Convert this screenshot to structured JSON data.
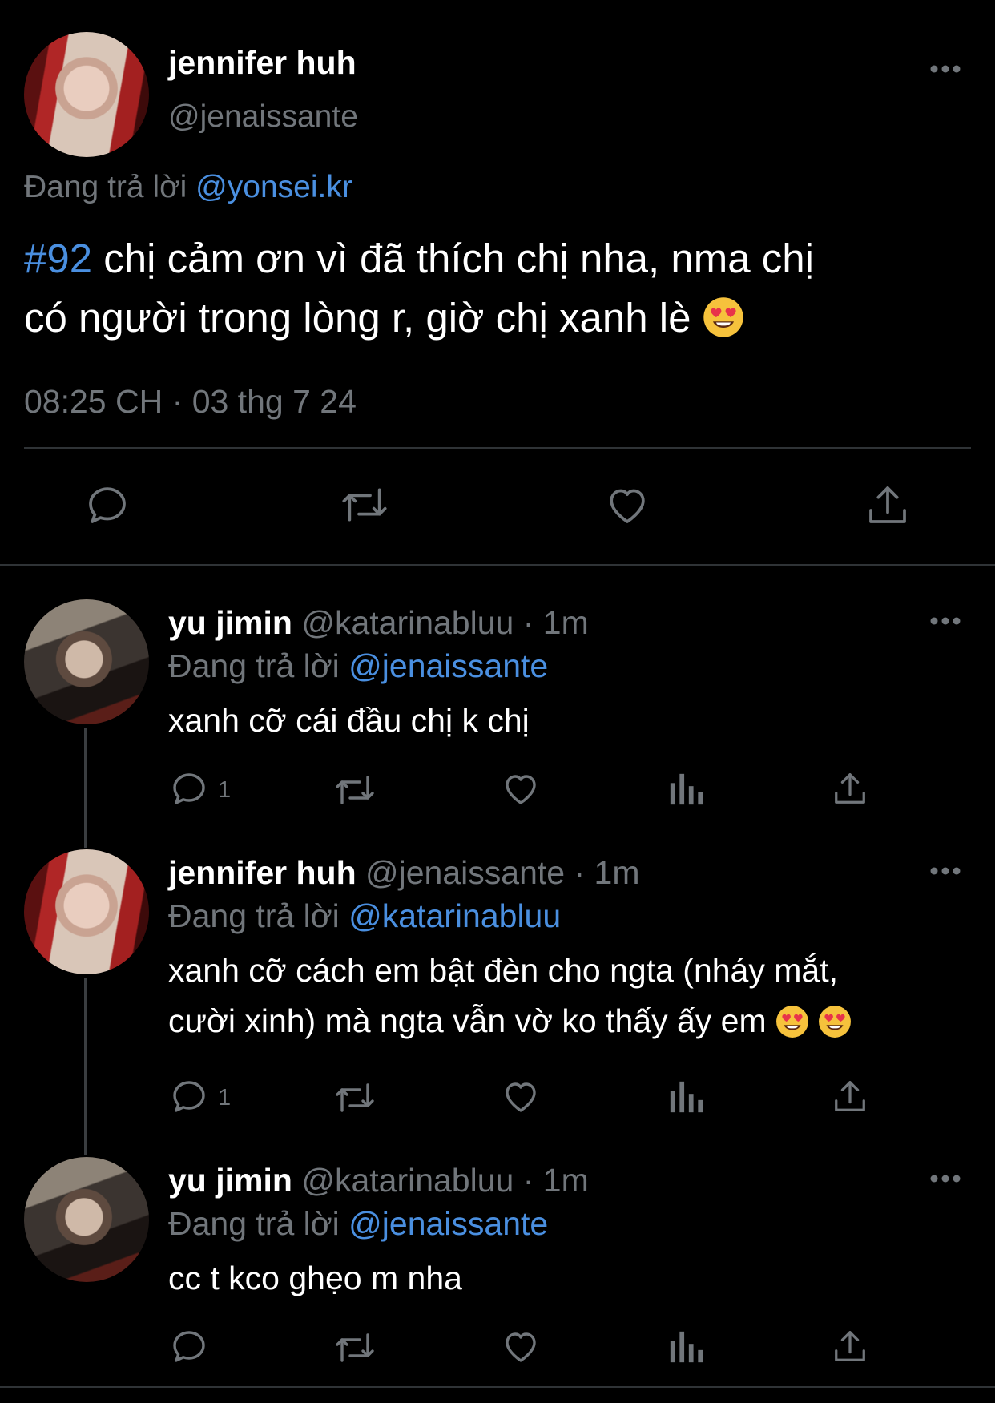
{
  "main_tweet": {
    "name": "jennifer huh",
    "handle": "@jenaissante",
    "replying_label": "Đang trả lời",
    "replying_to": "@yonsei.kr",
    "hashtag": "#92",
    "text_line1": " chị cảm ơn vì đã thích chị nha, nma chị",
    "text_line2": "có người trong lòng r, giờ chị xanh lè",
    "time": "08:25 CH",
    "separator": "·",
    "date": "03 thg 7 24"
  },
  "replies": [
    {
      "name": "yu jimin",
      "handle": "@katarinabluu",
      "time": "· 1m",
      "replying_label": "Đang trả lời",
      "replying_to": "@jenaissante",
      "text": "xanh cỡ cái đầu chị k chị",
      "reply_count": "1"
    },
    {
      "name": "jennifer huh",
      "handle": "@jenaissante",
      "time": "· 1m",
      "replying_label": "Đang trả lời",
      "replying_to": "@katarinabluu",
      "text_line1": "xanh cỡ cách em bật đèn cho ngta (nháy mắt,",
      "text_line2": "cười xinh) mà ngta vẫn vờ ko thấy ấy em",
      "reply_count": "1"
    },
    {
      "name": "yu jimin",
      "handle": "@katarinabluu",
      "time": "· 1m",
      "replying_label": "Đang trả lời",
      "replying_to": "@jenaissante",
      "text": "cc t kco ghẹo m nha",
      "reply_count": ""
    }
  ],
  "colors": {
    "background": "#000000",
    "link": "#4a8fe0",
    "muted": "#71767b",
    "text": "#e7e9ea"
  },
  "icons": [
    "more-icon",
    "reply-icon",
    "retweet-icon",
    "like-icon",
    "share-icon",
    "views-icon",
    "heart-eyes-emoji"
  ]
}
